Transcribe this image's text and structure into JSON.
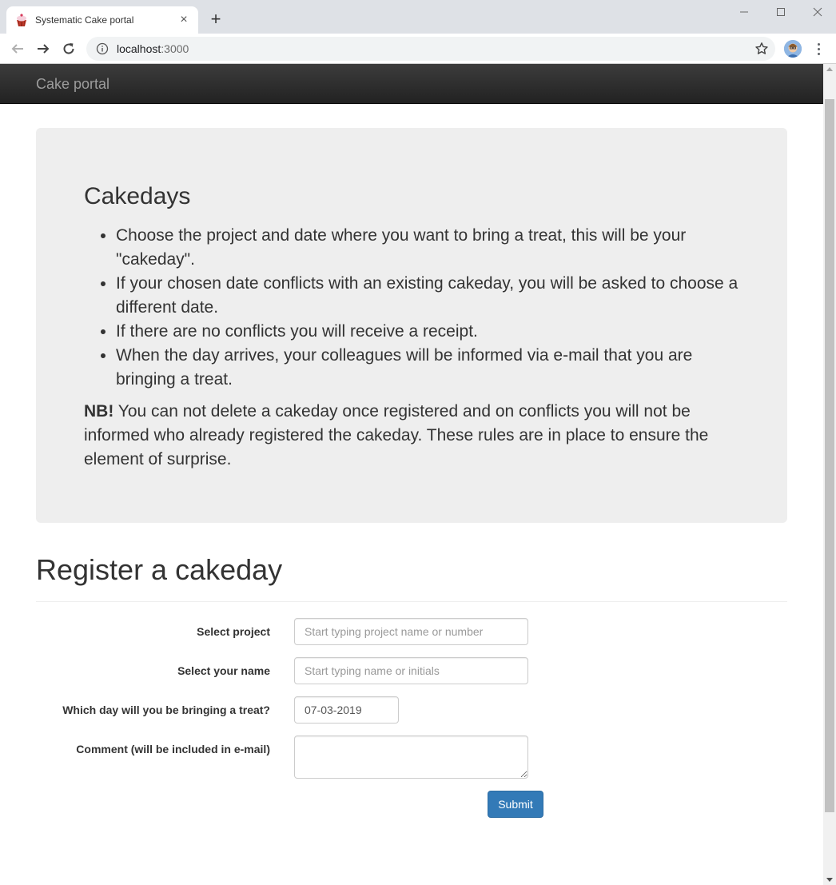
{
  "browser": {
    "tab_title": "Systematic Cake portal",
    "url_host": "localhost",
    "url_port": ":3000"
  },
  "navbar": {
    "brand": "Cake portal"
  },
  "info": {
    "heading": "Cakedays",
    "bullets": [
      "Choose the project and date where you want to bring a treat, this will be your \"cakeday\".",
      "If your chosen date conflicts with an existing cakeday, you will be asked to choose a different date.",
      "If there are no conflicts you will receive a receipt.",
      "When the day arrives, your colleagues will be informed via e-mail that you are bringing a treat."
    ],
    "note_bold": "NB!",
    "note_text": " You can not delete a cakeday once registered and on conflicts you will not be informed who already registered the cakeday. These rules are in place to ensure the element of surprise."
  },
  "form": {
    "title": "Register a cakeday",
    "project_label": "Select project",
    "project_placeholder": "Start typing project name or number",
    "name_label": "Select your name",
    "name_placeholder": "Start typing name or initials",
    "date_label": "Which day will you be bringing a treat?",
    "date_value": "07-03-2019",
    "comment_label": "Comment (will be included in e-mail)",
    "comment_value": "",
    "submit_label": "Submit"
  },
  "colors": {
    "navbar": "#222222",
    "jumbotron": "#eeeeee",
    "primary": "#337ab7"
  }
}
